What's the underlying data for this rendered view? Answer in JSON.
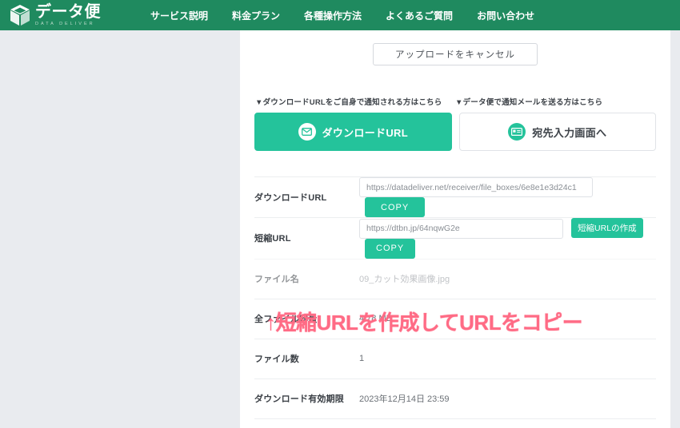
{
  "header": {
    "logo": {
      "icon": "cube-icon",
      "main_text": "データ便",
      "sub_text": "DATA DELIVER"
    },
    "nav": [
      {
        "label": "サービス説明"
      },
      {
        "label": "料金プラン"
      },
      {
        "label": "各種操作方法"
      },
      {
        "label": "よくあるご質問"
      },
      {
        "label": "お問い合わせ"
      }
    ]
  },
  "main": {
    "cancel_upload_label": "アップロードをキャンセル",
    "choice": {
      "left_note": "▼ダウンロードURLをご自身で通知される方はこちら",
      "right_note": "▼データ便で通知メールを送る方はこちら",
      "left_button": {
        "label": "ダウンロードURL",
        "icon": "envelope-icon"
      },
      "right_button": {
        "label": "宛先入力画面へ",
        "icon": "address-card-icon"
      }
    },
    "rows": {
      "download_url": {
        "label": "ダウンロードURL",
        "value": "https://datadeliver.net/receiver/file_boxes/6e8e1e3d24c1",
        "copy_label": "COPY"
      },
      "short_url": {
        "label": "短縮URL",
        "value": "https://dtbn.jp/64nqwG2e",
        "create_label": "短縮URLの作成",
        "copy_label": "COPY"
      },
      "file_name": {
        "label": "ファイル名",
        "value": "09_カット効果画像.jpg"
      },
      "total_size": {
        "label": "全ファイル容量",
        "value": "4.78 MB"
      },
      "file_count": {
        "label": "ファイル数",
        "value": "1"
      },
      "expiry": {
        "label": "ダウンロード有効期限",
        "value": "2023年12月14日 23:59"
      }
    },
    "annotation": "↑短縮URLを作成してURLをコピー"
  },
  "colors": {
    "header_green": "#1f8a5f",
    "accent_teal": "#24c39b",
    "annotation_pink": "#ff6b85",
    "page_gray": "#e9ebef"
  }
}
